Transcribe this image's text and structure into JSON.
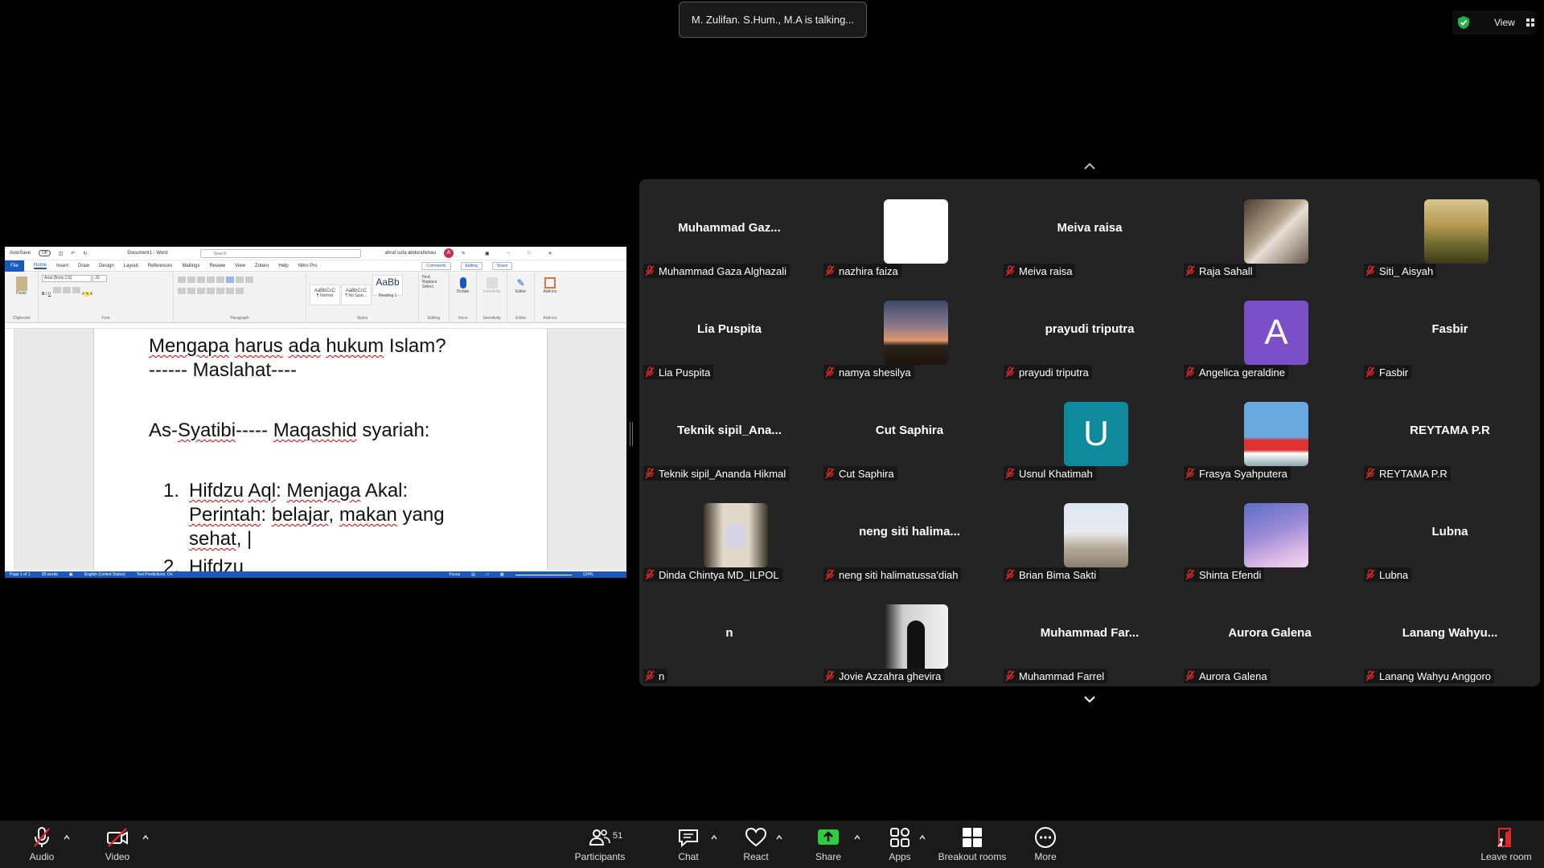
{
  "meeting": {
    "talking_text": "M. Zulifan. S.Hum., M.A is talking...",
    "view_label": "View"
  },
  "word": {
    "autosave": "AutoSave",
    "autosave_state": "Off",
    "file_name": "Document1 - Word",
    "search_placeholder": "Search",
    "user_name": "ahraf sufa abdurahimau",
    "user_initial": "A",
    "tabs": [
      "File",
      "Home",
      "Insert",
      "Draw",
      "Design",
      "Layout",
      "References",
      "Mailings",
      "Review",
      "View",
      "Zotero",
      "Help",
      "Nitro Pro"
    ],
    "buttons": {
      "comments": "Comments",
      "editing": "Editing",
      "share": "Share"
    },
    "font_name": "Arial (Body CS)",
    "font_size": "26",
    "ribbon_groups": [
      "Clipboard",
      "Font",
      "Paragraph",
      "Styles",
      "Editing",
      "Voice",
      "Sensitivity",
      "Editor",
      "Add-ins"
    ],
    "styles": [
      "AaBbCcC",
      "AaBbCcC",
      "AaBb"
    ],
    "style_names": [
      "¶ Normal",
      "¶ No Spac...",
      "Heading 1"
    ],
    "editing_items": [
      "Find",
      "Replace",
      "Select"
    ],
    "paste_label": "Paste",
    "dictate_label": "Dictate",
    "sensitivity_label": "Sensitivity",
    "editor_label": "Editor",
    "addins_label": "Add-ins",
    "doc": {
      "line1_a": "Mengapa",
      "line1_b": "harus",
      "line1_c": "ada",
      "line1_d": "hukum",
      "line1_e": "Islam?",
      "line2": "------ Maslahat----",
      "line3_a": "As-",
      "line3_b": "Syatibi",
      "line3_c": "----- ",
      "line3_d": "Maqashid",
      "line3_e": " syariah:",
      "item1_num": "1.",
      "item1_a": "Hifdzu",
      "item1_b": "Aql",
      "item1_c": ": ",
      "item1_d": "Menjaga",
      "item1_e": " Akal:",
      "item1_f": "Perintah",
      "item1_g": ": ",
      "item1_h": "belajar",
      "item1_i": ", ",
      "item1_j": "makan",
      "item1_k": " yang",
      "item1_l": "sehat",
      "item1_m": ", |",
      "item2_num": "2.",
      "item2_a": "Hifdzu"
    },
    "status": {
      "page": "Page 1 of 1",
      "words": "28 words",
      "language": "English (United States)",
      "predictions": "Text Predictions: On",
      "focus": "Focus",
      "zoom": "124%"
    }
  },
  "participants": [
    {
      "display": "Muhammad  Gaz...",
      "name": "Muhammad Gaza Alghazali",
      "type": "text"
    },
    {
      "display": "",
      "name": "nazhira faiza",
      "type": "white"
    },
    {
      "display": "Meiva raisa",
      "name": "Meiva raisa",
      "type": "text"
    },
    {
      "display": "",
      "name": "Raja Sahall",
      "type": "photo-man"
    },
    {
      "display": "",
      "name": "Siti_ Aisyah",
      "type": "photo-landscape"
    },
    {
      "display": "Lia Puspita",
      "name": "Lia Puspita",
      "type": "text"
    },
    {
      "display": "",
      "name": "namya shesilya",
      "type": "photo-sunset"
    },
    {
      "display": "prayudi triputra",
      "name": "prayudi triputra",
      "type": "text"
    },
    {
      "display": "A",
      "name": "Angelica geraldine",
      "type": "letter",
      "color": "#7b4fc8"
    },
    {
      "display": "Fasbir",
      "name": "Fasbir",
      "type": "text"
    },
    {
      "display": "Teknik  sipil_Ana...",
      "name": "Teknik sipil_Ananda Hikmal",
      "type": "text"
    },
    {
      "display": "Cut Saphira",
      "name": "Cut Saphira",
      "type": "text"
    },
    {
      "display": "U",
      "name": "Usnul Khatimah",
      "type": "letter",
      "color": "#0e8a9c"
    },
    {
      "display": "",
      "name": "Frasya Syahputera",
      "type": "photo-car"
    },
    {
      "display": "REYTAMA P.R",
      "name": "REYTAMA P.R",
      "type": "text"
    },
    {
      "display": "",
      "name": "Dinda Chintya MD_ILPOL",
      "type": "photo-girl"
    },
    {
      "display": "neng  siti  halima...",
      "name": "neng siti halimatussa'diah",
      "type": "text"
    },
    {
      "display": "",
      "name": "Brian Bima Sakti",
      "type": "photo-couple"
    },
    {
      "display": "",
      "name": "Shinta Efendi",
      "type": "photo-purple"
    },
    {
      "display": "Lubna",
      "name": "Lubna",
      "type": "text"
    },
    {
      "display": "n",
      "name": "n",
      "type": "text"
    },
    {
      "display": "",
      "name": "Jovie Azzahra ghevira",
      "type": "photo-silhouette"
    },
    {
      "display": "Muhammad  Far...",
      "name": "Muhammad Farrel",
      "type": "text"
    },
    {
      "display": "Aurora Galena",
      "name": "Aurora Galena",
      "type": "text"
    },
    {
      "display": "Lanang  Wahyu...",
      "name": "Lanang Wahyu Anggoro",
      "type": "text"
    }
  ],
  "toolbar": {
    "audio": "Audio",
    "video": "Video",
    "participants": "Participants",
    "participants_count": "51",
    "chat": "Chat",
    "react": "React",
    "share": "Share",
    "apps": "Apps",
    "breakout": "Breakout rooms",
    "more": "More",
    "leave": "Leave room"
  },
  "colors": {
    "share_green": "#2ecc40",
    "muted_red": "#e02828",
    "leave_red": "#e02828",
    "word_blue": "#185abd"
  }
}
